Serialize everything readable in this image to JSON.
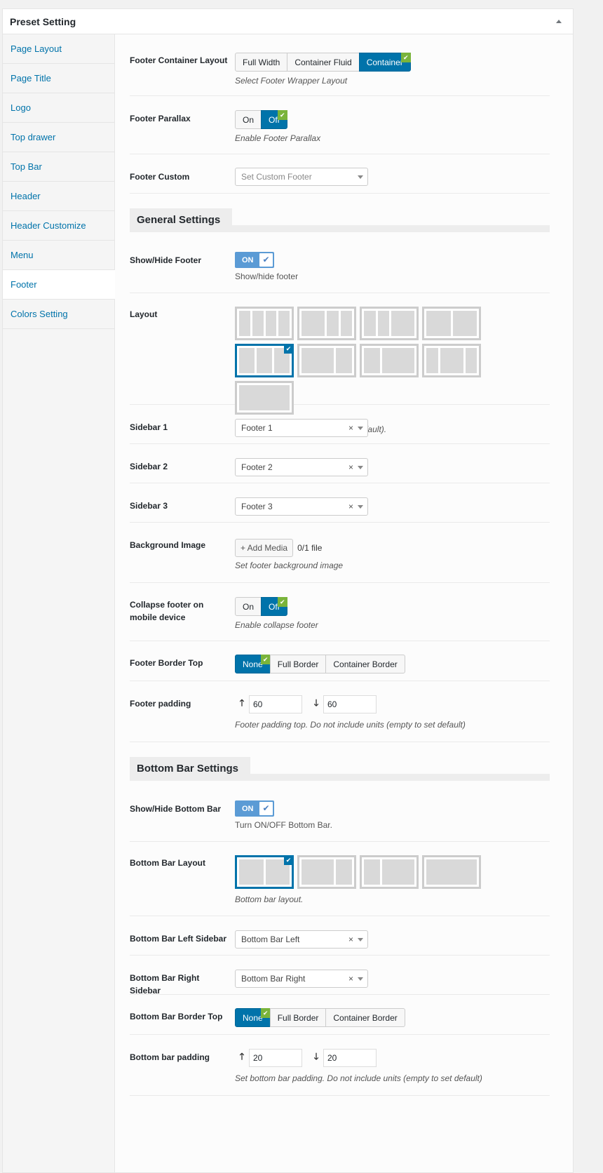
{
  "panel": {
    "title": "Preset Setting"
  },
  "tabs": [
    {
      "label": "Page Layout"
    },
    {
      "label": "Page Title"
    },
    {
      "label": "Logo"
    },
    {
      "label": "Top drawer"
    },
    {
      "label": "Top Bar"
    },
    {
      "label": "Header"
    },
    {
      "label": "Header Customize"
    },
    {
      "label": "Menu"
    },
    {
      "label": "Footer",
      "active": true
    },
    {
      "label": "Colors Setting"
    }
  ],
  "footer_container": {
    "label": "Footer Container Layout",
    "options": [
      "Full Width",
      "Container Fluid",
      "Container"
    ],
    "selected": "Container",
    "desc": "Select Footer Wrapper Layout"
  },
  "footer_parallax": {
    "label": "Footer Parallax",
    "options": [
      "On",
      "Off"
    ],
    "selected": "Off",
    "desc": "Enable Footer Parallax"
  },
  "footer_custom": {
    "label": "Footer Custom",
    "placeholder": "Set Custom Footer"
  },
  "general_settings": {
    "title": "General Settings"
  },
  "show_footer": {
    "label": "Show/Hide Footer",
    "toggle": "ON",
    "desc": "Show/hide footer"
  },
  "layout": {
    "label": "Layout",
    "desc": "Select Footer Layout (Not set to default)."
  },
  "sidebar1": {
    "label": "Sidebar 1",
    "value": "Footer 1"
  },
  "sidebar2": {
    "label": "Sidebar 2",
    "value": "Footer 2"
  },
  "sidebar3": {
    "label": "Sidebar 3",
    "value": "Footer 3"
  },
  "bg_image": {
    "label": "Background Image",
    "button": "+ Add Media",
    "count": "0/1 file",
    "desc": "Set footer background image"
  },
  "collapse_footer": {
    "label": "Collapse footer on mobile device",
    "options": [
      "On",
      "Off"
    ],
    "selected": "Off",
    "desc": "Enable collapse footer"
  },
  "footer_border": {
    "label": "Footer Border Top",
    "options": [
      "None",
      "Full Border",
      "Container Border"
    ],
    "selected": "None"
  },
  "footer_padding": {
    "label": "Footer padding",
    "top": "60",
    "bottom": "60",
    "desc": "Footer padding top. Do not include units (empty to set default)"
  },
  "bottom_bar_settings": {
    "title": "Bottom Bar Settings"
  },
  "show_bottom_bar": {
    "label": "Show/Hide Bottom Bar",
    "toggle": "ON",
    "desc": "Turn ON/OFF Bottom Bar."
  },
  "bottom_layout": {
    "label": "Bottom Bar Layout",
    "desc": "Bottom bar layout."
  },
  "bb_left": {
    "label": "Bottom Bar Left Sidebar",
    "value": "Bottom Bar Left"
  },
  "bb_right": {
    "label": "Bottom Bar Right Sidebar",
    "value": "Bottom Bar Right"
  },
  "bb_border": {
    "label": "Bottom Bar Border Top",
    "options": [
      "None",
      "Full Border",
      "Container Border"
    ],
    "selected": "None"
  },
  "bb_padding": {
    "label": "Bottom bar padding",
    "top": "20",
    "bottom": "20",
    "desc": "Set bottom bar padding. Do not include units (empty to set default)"
  }
}
